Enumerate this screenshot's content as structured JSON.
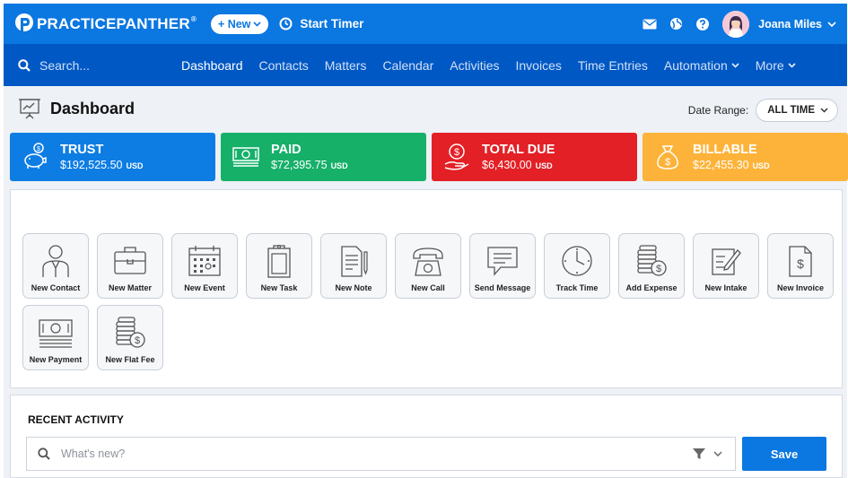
{
  "topbar": {
    "logo_text": "PRACTICEPANTHER",
    "logo_reg": "®",
    "new_label": "+ New",
    "timer_label": "Start Timer",
    "user_name": "Joana Miles"
  },
  "navbar": {
    "search_placeholder": "Search...",
    "items": [
      {
        "label": "Dashboard",
        "active": true
      },
      {
        "label": "Contacts"
      },
      {
        "label": "Matters"
      },
      {
        "label": "Calendar"
      },
      {
        "label": "Activities"
      },
      {
        "label": "Invoices"
      },
      {
        "label": "Time Entries"
      },
      {
        "label": "Automation",
        "dropdown": true
      },
      {
        "label": "More",
        "dropdown": true
      }
    ]
  },
  "header": {
    "title": "Dashboard",
    "date_range_label": "Date Range:",
    "date_range_value": "ALL TIME"
  },
  "cards": [
    {
      "title": "TRUST",
      "amount": "$192,525.50",
      "currency": "USD",
      "color": "#0d7de4",
      "icon": "piggy-bank-icon"
    },
    {
      "title": "PAID",
      "amount": "$72,395.75",
      "currency": "USD",
      "color": "#16b069",
      "icon": "cash-icon"
    },
    {
      "title": "TOTAL DUE",
      "amount": "$6,430.00",
      "currency": "USD",
      "color": "#e32026",
      "icon": "hand-dollar-icon"
    },
    {
      "title": "BILLABLE",
      "amount": "$22,455.30",
      "currency": "USD",
      "color": "#fdb33a",
      "icon": "money-bag-icon"
    }
  ],
  "quick_actions": [
    {
      "label": "New Contact",
      "icon": "contact-icon"
    },
    {
      "label": "New Matter",
      "icon": "briefcase-icon"
    },
    {
      "label": "New Event",
      "icon": "calendar-icon"
    },
    {
      "label": "New Task",
      "icon": "clipboard-icon"
    },
    {
      "label": "New Note",
      "icon": "note-icon"
    },
    {
      "label": "New Call",
      "icon": "phone-icon"
    },
    {
      "label": "Send Message",
      "icon": "message-icon"
    },
    {
      "label": "Track Time",
      "icon": "clock-icon"
    },
    {
      "label": "Add Expense",
      "icon": "coins-icon"
    },
    {
      "label": "New Intake",
      "icon": "intake-icon"
    },
    {
      "label": "New Invoice",
      "icon": "invoice-icon"
    },
    {
      "label": "New Payment",
      "icon": "payment-icon"
    },
    {
      "label": "New Flat Fee",
      "icon": "flat-fee-icon"
    }
  ],
  "recent_activity": {
    "title": "RECENT ACTIVITY",
    "placeholder": "What's new?",
    "save_label": "Save"
  }
}
